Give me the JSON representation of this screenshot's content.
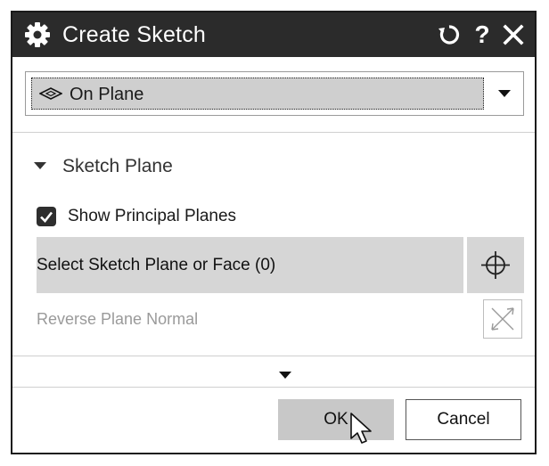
{
  "window": {
    "title": "Create Sketch",
    "title_icon": "gear-icon",
    "buttons": {
      "reset": "reset-icon",
      "help": "?",
      "close": "close-icon"
    }
  },
  "sketch_type": {
    "selected": "On Plane",
    "icon": "plane-icon"
  },
  "sketch_plane": {
    "group_title": "Sketch Plane",
    "show_principal_planes_label": "Show Principal Planes",
    "show_principal_planes_checked": true,
    "select_label": "Select Sketch Plane or Face (0)",
    "select_icon": "crosshair-icon",
    "reverse_label": "Reverse Plane Normal",
    "reverse_icon": "reverse-normal-icon",
    "reverse_enabled": false
  },
  "footer": {
    "ok_label": "OK",
    "cancel_label": "Cancel"
  },
  "colors": {
    "titlebar": "#2b2b2b",
    "row_highlight": "#d6d6d6",
    "disabled_text": "#9a9a9a"
  }
}
